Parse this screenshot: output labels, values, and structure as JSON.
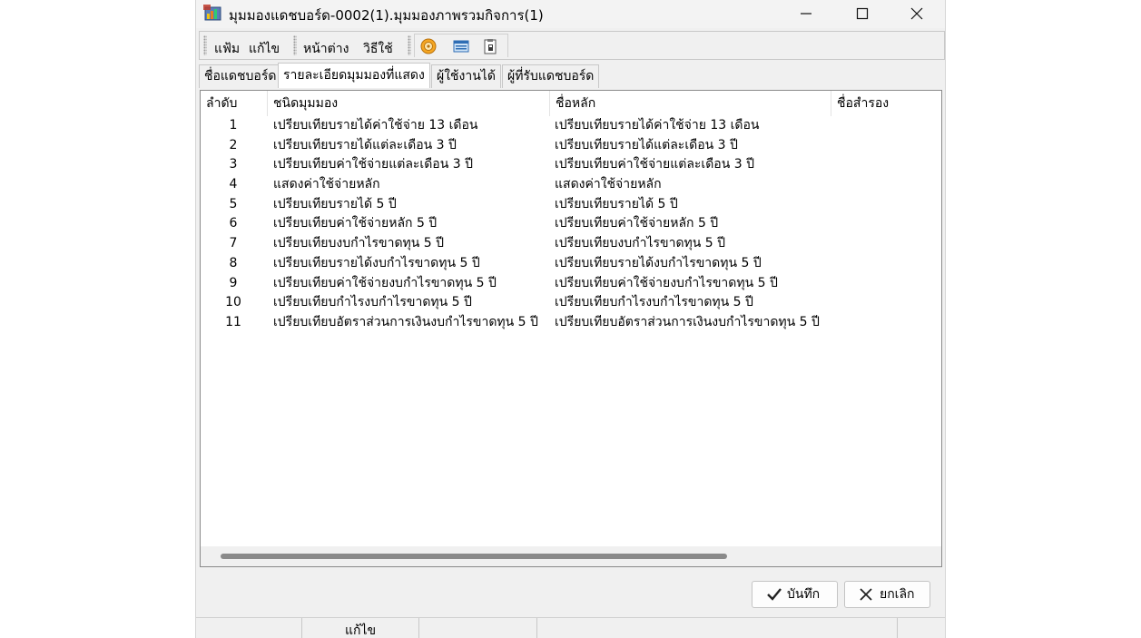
{
  "window": {
    "title": "มุมมองแดชบอร์ด-0002(1).มุมมองภาพรวมกิจการ(1)",
    "icon": "app-chart-icon"
  },
  "menu": {
    "items": [
      "แฟ้ม",
      "แก้ไข",
      "หน้าต่าง",
      "วิธีใช้"
    ],
    "toolbar_icons": [
      "disc-icon",
      "window-icon",
      "clipboard-icon"
    ]
  },
  "tabs": [
    {
      "label": "ชื่อแดชบอร์ด",
      "active": false
    },
    {
      "label": "รายละเอียดมุมมองที่แสดง",
      "active": true
    },
    {
      "label": "ผู้ใช้งานได้",
      "active": false
    },
    {
      "label": "ผู้ที่รับแดชบอร์ด",
      "active": false
    }
  ],
  "table": {
    "columns": [
      "ลำดับ",
      "ชนิดมุมมอง",
      "ชื่อหลัก",
      "ชื่อสำรอง"
    ],
    "rows": [
      {
        "no": "1",
        "type": "เปรียบเทียบรายได้ค่าใช้จ่าย  13 เดือน",
        "main": "เปรียบเทียบรายได้ค่าใช้จ่าย  13 เดือน"
      },
      {
        "no": "2",
        "type": "เปรียบเทียบรายได้แต่ละเดือน 3 ปี",
        "main": "เปรียบเทียบรายได้แต่ละเดือน 3 ปี"
      },
      {
        "no": "3",
        "type": "เปรียบเทียบค่าใช้จ่ายแต่ละเดือน 3 ปี",
        "main": "เปรียบเทียบค่าใช้จ่ายแต่ละเดือน 3 ปี"
      },
      {
        "no": "4",
        "type": "แสดงค่าใช้จ่ายหลัก",
        "main": "แสดงค่าใช้จ่ายหลัก"
      },
      {
        "no": "5",
        "type": "เปรียบเทียบรายได้ 5 ปี",
        "main": "เปรียบเทียบรายได้ 5 ปี"
      },
      {
        "no": "6",
        "type": "เปรียบเทียบค่าใช้จ่ายหลัก 5 ปี",
        "main": "เปรียบเทียบค่าใช้จ่ายหลัก 5 ปี"
      },
      {
        "no": "7",
        "type": "เปรียบเทียบงบกำไรขาดทุน 5 ปี",
        "main": "เปรียบเทียบงบกำไรขาดทุน 5 ปี"
      },
      {
        "no": "8",
        "type": "เปรียบเทียบรายได้งบกำไรขาดทุน 5 ปี",
        "main": "เปรียบเทียบรายได้งบกำไรขาดทุน 5 ปี"
      },
      {
        "no": "9",
        "type": "เปรียบเทียบค่าใช้จ่ายงบกำไรขาดทุน 5 ปี",
        "main": "เปรียบเทียบค่าใช้จ่ายงบกำไรขาดทุน 5 ปี"
      },
      {
        "no": "10",
        "type": "เปรียบเทียบกำไรงบกำไรขาดทุน 5 ปี",
        "main": "เปรียบเทียบกำไรงบกำไรขาดทุน 5 ปี"
      },
      {
        "no": "11",
        "type": "เปรียบเทียบอัตราส่วนการเงินงบกำไรขาดทุน 5 ปี",
        "main": "เปรียบเทียบอัตราส่วนการเงินงบกำไรขาดทุน 5 ปี"
      }
    ]
  },
  "buttons": {
    "save": "บันทึก",
    "cancel": "ยกเลิก"
  },
  "status": {
    "mode": "แก้ไข"
  },
  "colors": {
    "window_bg": "#f0f0f0",
    "save_check": "#222222"
  }
}
